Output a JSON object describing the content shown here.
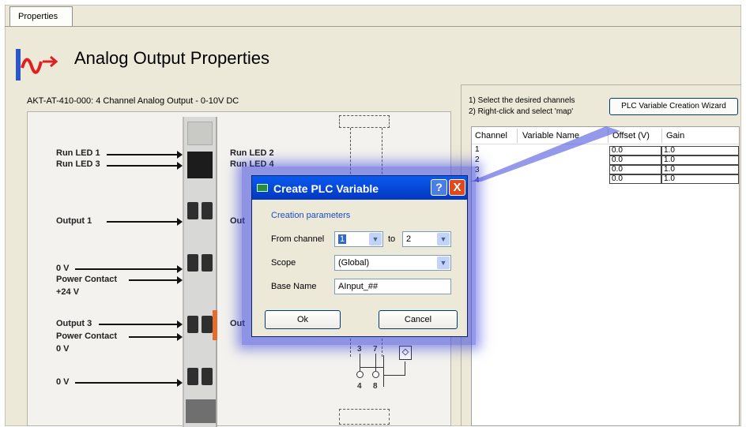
{
  "tab": {
    "label": "Properties"
  },
  "header": {
    "title": "Analog Output Properties"
  },
  "device": {
    "description": "AKT-AT-410-000: 4 Channel Analog Output - 0-10V DC"
  },
  "diagram": {
    "left_labels": [
      "Run LED 1",
      "Run LED 3",
      "Output 1",
      "0 V",
      "Power Contact",
      "+24 V",
      "Output 3",
      "Power Contact",
      "0 V",
      "0 V"
    ],
    "right_labels": [
      "Run LED 2",
      "Run LED 4",
      "Out",
      "Out"
    ],
    "terminal_numbers": [
      "3",
      "7",
      "4",
      "8"
    ]
  },
  "instructions": {
    "line1": "1) Select the desired channels",
    "line2": "2) Right-click and select 'map'"
  },
  "wizard_button": {
    "label": "PLC Variable Creation Wizard"
  },
  "grid": {
    "headers": {
      "channel": "Channel",
      "variable_name": "Variable Name",
      "offset": "Offset (V)",
      "gain": "Gain"
    },
    "rows": [
      {
        "channel": "1",
        "offset": "0.0",
        "gain": "1.0"
      },
      {
        "channel": "2",
        "offset": "0.0",
        "gain": "1.0"
      },
      {
        "channel": "3",
        "offset": "0.0",
        "gain": "1.0"
      },
      {
        "channel": "4",
        "offset": "0.0",
        "gain": "1.0"
      }
    ]
  },
  "dialog": {
    "title": "Create PLC Variable",
    "help": "?",
    "close": "X",
    "section": "Creation parameters",
    "from_channel_label": "From channel",
    "from_value": "1",
    "to_label": "to",
    "to_value": "2",
    "scope_label": "Scope",
    "scope_value": "(Global)",
    "base_name_label": "Base Name",
    "base_name_value": "AInput_##",
    "ok_label": "Ok",
    "cancel_label": "Cancel"
  }
}
